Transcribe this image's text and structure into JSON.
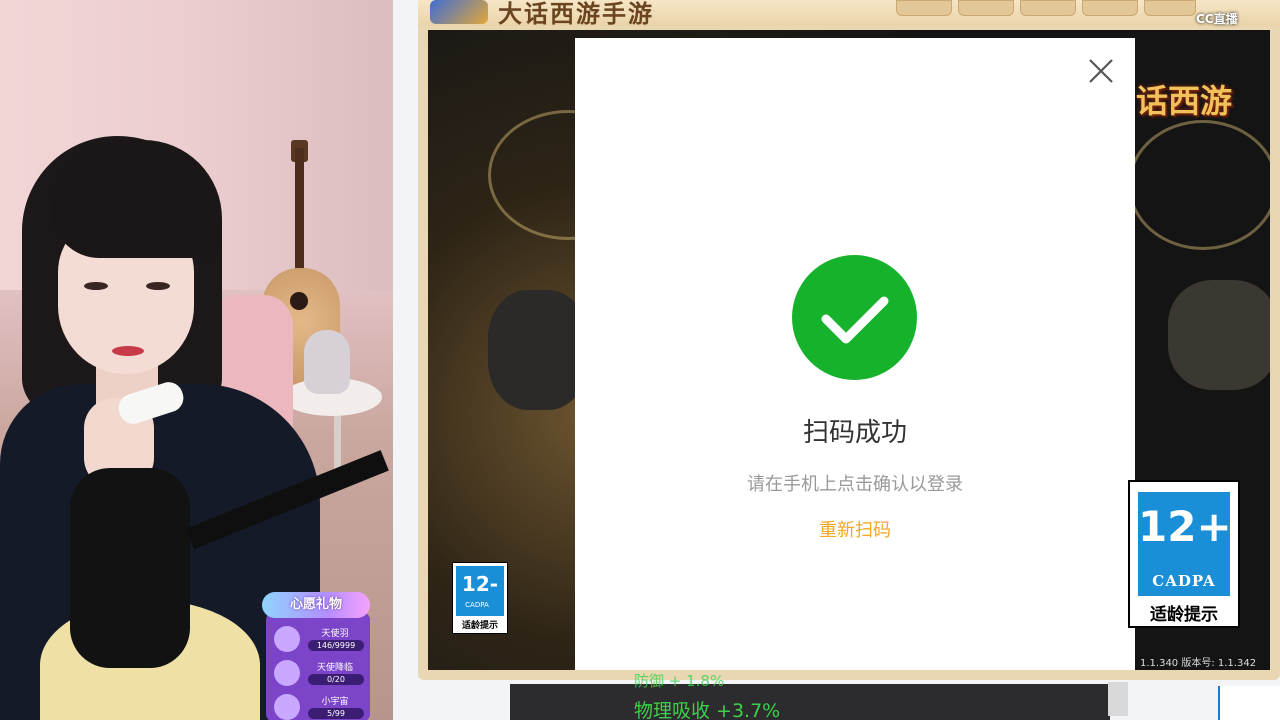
{
  "window": {
    "title": "大话西游手游",
    "watermark": "CC直播"
  },
  "dialog": {
    "title": "扫码成功",
    "subtitle": "请在手机上点击确认以登录",
    "rescan_label": "重新扫码"
  },
  "game": {
    "logo_text": "话西游",
    "version_text": "1.1.340 版本号: 1.1.342"
  },
  "age_badge_small": {
    "number": "12-",
    "org": "CADPA",
    "tip": "适龄提示"
  },
  "age_badge_large": {
    "number": "12+",
    "org": "CADPA",
    "tip": "适龄提示"
  },
  "wish_widget": {
    "title": "心愿礼物",
    "items": [
      {
        "name": "天使羽",
        "count": "146/9999"
      },
      {
        "name": "天使降临",
        "count": "0/20"
      },
      {
        "name": "小宇宙",
        "count": "5/99"
      }
    ]
  },
  "stats": {
    "line_top": "防御 + 1.8%",
    "line_bottom": "物理吸收 +3.7%"
  },
  "colors": {
    "success_green": "#17b22b",
    "rescan_orange": "#f5a623",
    "age_blue": "#1a8fd8"
  }
}
